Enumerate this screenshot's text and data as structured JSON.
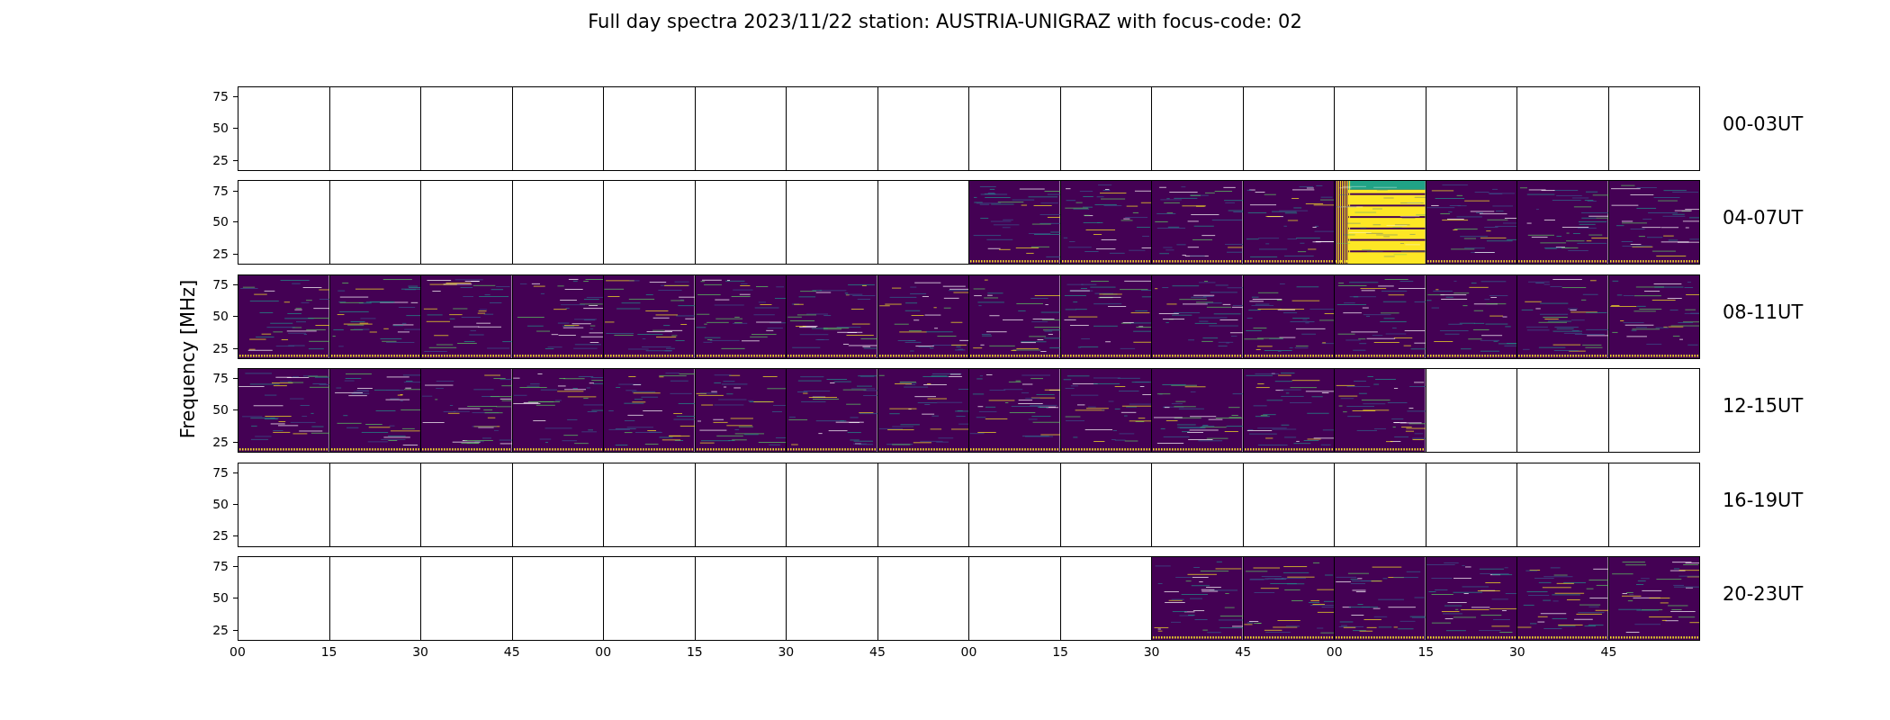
{
  "title": "Full day spectra 2023/11/22 station: AUSTRIA-UNIGRAZ with focus-code: 02",
  "ylabel": "Frequency [MHz]",
  "rows": [
    {
      "label": "00-03UT",
      "yticks": [
        "75",
        "50",
        "25"
      ],
      "panels": [
        {
          "kind": "blank"
        },
        {
          "kind": "blank"
        },
        {
          "kind": "blank"
        },
        {
          "kind": "blank"
        },
        {
          "kind": "blank"
        },
        {
          "kind": "blank"
        },
        {
          "kind": "blank"
        },
        {
          "kind": "blank"
        },
        {
          "kind": "blank"
        },
        {
          "kind": "blank"
        },
        {
          "kind": "blank"
        },
        {
          "kind": "blank"
        },
        {
          "kind": "blank"
        },
        {
          "kind": "blank"
        },
        {
          "kind": "blank"
        },
        {
          "kind": "blank"
        }
      ]
    },
    {
      "label": "04-07UT",
      "yticks": [
        "75",
        "50",
        "25"
      ],
      "panels": [
        {
          "kind": "blank"
        },
        {
          "kind": "blank"
        },
        {
          "kind": "blank"
        },
        {
          "kind": "blank"
        },
        {
          "kind": "blank"
        },
        {
          "kind": "blank"
        },
        {
          "kind": "blank"
        },
        {
          "kind": "blank"
        },
        {
          "kind": "spectrum"
        },
        {
          "kind": "spectrum"
        },
        {
          "kind": "spectrum"
        },
        {
          "kind": "spectrum"
        },
        {
          "kind": "burst"
        },
        {
          "kind": "spectrum"
        },
        {
          "kind": "spectrum"
        },
        {
          "kind": "spectrum"
        }
      ]
    },
    {
      "label": "08-11UT",
      "yticks": [
        "75",
        "50",
        "25"
      ],
      "panels": [
        {
          "kind": "spectrum"
        },
        {
          "kind": "spectrum"
        },
        {
          "kind": "spectrum"
        },
        {
          "kind": "spectrum"
        },
        {
          "kind": "spectrum"
        },
        {
          "kind": "spectrum"
        },
        {
          "kind": "spectrum"
        },
        {
          "kind": "spectrum"
        },
        {
          "kind": "spectrum"
        },
        {
          "kind": "spectrum"
        },
        {
          "kind": "spectrum"
        },
        {
          "kind": "spectrum"
        },
        {
          "kind": "spectrum"
        },
        {
          "kind": "spectrum"
        },
        {
          "kind": "spectrum"
        },
        {
          "kind": "spectrum"
        }
      ]
    },
    {
      "label": "12-15UT",
      "yticks": [
        "75",
        "50",
        "25"
      ],
      "panels": [
        {
          "kind": "spectrum"
        },
        {
          "kind": "spectrum"
        },
        {
          "kind": "spectrum"
        },
        {
          "kind": "spectrum"
        },
        {
          "kind": "spectrum"
        },
        {
          "kind": "spectrum"
        },
        {
          "kind": "spectrum"
        },
        {
          "kind": "spectrum"
        },
        {
          "kind": "spectrum"
        },
        {
          "kind": "spectrum"
        },
        {
          "kind": "spectrum"
        },
        {
          "kind": "spectrum"
        },
        {
          "kind": "spectrum"
        },
        {
          "kind": "blank"
        },
        {
          "kind": "blank"
        },
        {
          "kind": "blank"
        }
      ]
    },
    {
      "label": "16-19UT",
      "yticks": [
        "75",
        "50",
        "25"
      ],
      "panels": [
        {
          "kind": "blank"
        },
        {
          "kind": "blank"
        },
        {
          "kind": "blank"
        },
        {
          "kind": "blank"
        },
        {
          "kind": "blank"
        },
        {
          "kind": "blank"
        },
        {
          "kind": "blank"
        },
        {
          "kind": "blank"
        },
        {
          "kind": "blank"
        },
        {
          "kind": "blank"
        },
        {
          "kind": "blank"
        },
        {
          "kind": "blank"
        },
        {
          "kind": "blank"
        },
        {
          "kind": "blank"
        },
        {
          "kind": "blank"
        },
        {
          "kind": "blank"
        }
      ]
    },
    {
      "label": "20-23UT",
      "yticks": [
        "75",
        "50",
        "25"
      ],
      "panels": [
        {
          "kind": "blank"
        },
        {
          "kind": "blank"
        },
        {
          "kind": "blank"
        },
        {
          "kind": "blank"
        },
        {
          "kind": "blank"
        },
        {
          "kind": "blank"
        },
        {
          "kind": "blank"
        },
        {
          "kind": "blank"
        },
        {
          "kind": "blank"
        },
        {
          "kind": "blank"
        },
        {
          "kind": "spectrum"
        },
        {
          "kind": "spectrum"
        },
        {
          "kind": "spectrum"
        },
        {
          "kind": "spectrum"
        },
        {
          "kind": "spectrum"
        },
        {
          "kind": "spectrum"
        }
      ]
    }
  ],
  "xticks": [
    "00",
    "15",
    "30",
    "45",
    "00",
    "15",
    "30",
    "45",
    "00",
    "15",
    "30",
    "45",
    "00",
    "15",
    "30",
    "45"
  ]
}
